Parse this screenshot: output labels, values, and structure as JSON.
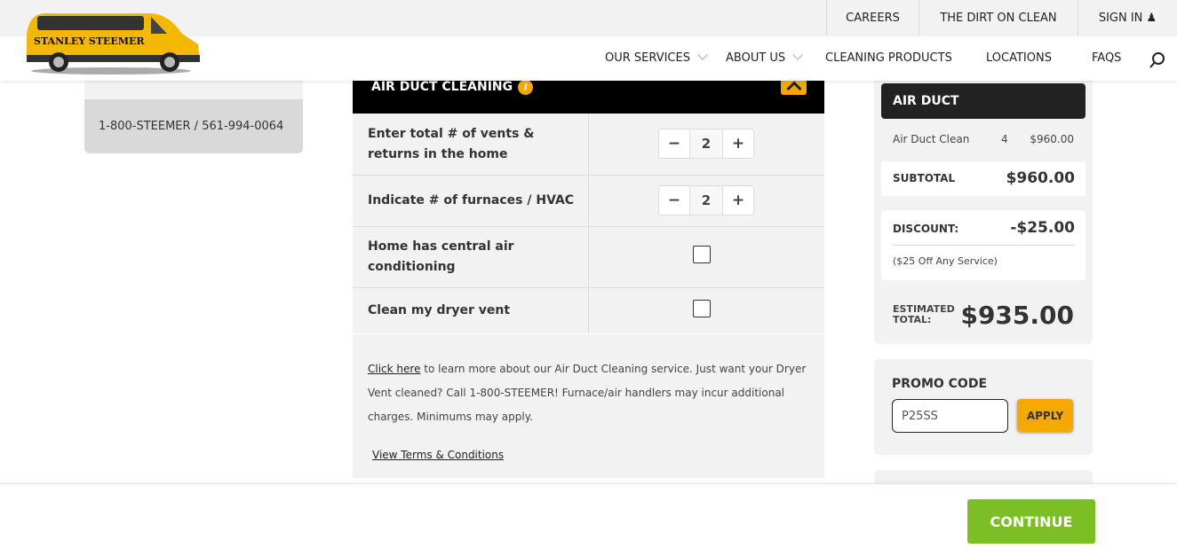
{
  "brand": {
    "logo_text": "STANLEY STEEMER"
  },
  "topbar": {
    "careers": "CAREERS",
    "dirt": "THE DIRT ON CLEAN",
    "signin": "SIGN IN"
  },
  "nav": {
    "services": "OUR SERVICES",
    "about": "ABOUT US",
    "products": "CLEANING PRODUCTS",
    "locations": "LOCATIONS",
    "faqs": "FAQS"
  },
  "left": {
    "phone": "1-800-STEEMER / 561-994-0064"
  },
  "panel": {
    "title": "AIR DUCT CLEANING",
    "rows": [
      {
        "label": "Enter total # of vents & returns in the home",
        "value": "2"
      },
      {
        "label": "Indicate # of furnaces / HVAC",
        "value": "2"
      },
      {
        "label": "Home has central air conditioning"
      },
      {
        "label": "Clean my dryer vent"
      }
    ],
    "note_link": "Click here",
    "note_text": " to learn more about our Air Duct Cleaning service. Just want your Dryer Vent cleaned? Call 1-800-STEEMER! Furnace/air handlers may incur additional charges. Minimums may apply.",
    "terms": "View Terms & Conditions",
    "minus": "−",
    "plus": "+"
  },
  "summary": {
    "header": "AIR DUCT",
    "item": {
      "name": "Air Duct Clean",
      "qty": "4",
      "price": "$960.00"
    },
    "subtotal_label": "SUBTOTAL",
    "subtotal": "$960.00",
    "discount_label": "DISCOUNT:",
    "discount": "-$25.00",
    "discount_desc": "($25 Off Any Service)",
    "total_label_1": "ESTIMATED",
    "total_label_2": "TOTAL:",
    "total": "$935.00"
  },
  "promo": {
    "label": "PROMO CODE",
    "value": "P25SS",
    "apply": "APPLY"
  },
  "footer": {
    "continue": "CONTINUE"
  }
}
